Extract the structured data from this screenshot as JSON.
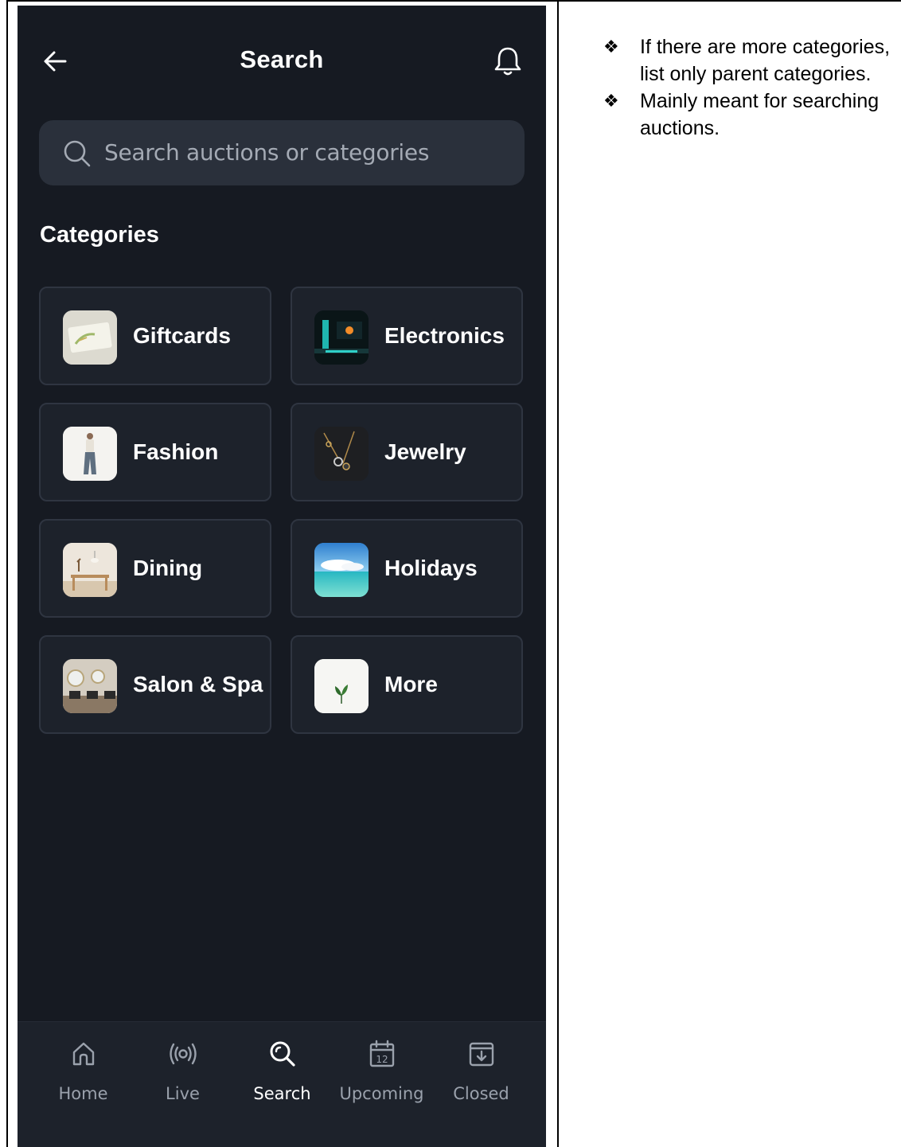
{
  "header": {
    "title": "Search",
    "back_icon": "arrow-left-icon",
    "bell_icon": "bell-icon"
  },
  "search": {
    "placeholder": "Search auctions or categories",
    "icon": "search-icon"
  },
  "categories_title": "Categories",
  "categories": [
    {
      "label": "Giftcards",
      "image": "giftcard-image"
    },
    {
      "label": "Electronics",
      "image": "electronics-image"
    },
    {
      "label": "Fashion",
      "image": "fashion-image"
    },
    {
      "label": "Jewelry",
      "image": "jewelry-image"
    },
    {
      "label": "Dining",
      "image": "dining-image"
    },
    {
      "label": "Holidays",
      "image": "holidays-image"
    },
    {
      "label": "Salon & Spa",
      "image": "salon-image"
    },
    {
      "label": "More",
      "image": "leaf-image"
    }
  ],
  "nav": [
    {
      "label": "Home",
      "icon": "home-icon",
      "active": false
    },
    {
      "label": "Live",
      "icon": "live-broadcast-icon",
      "active": false
    },
    {
      "label": "Search",
      "icon": "search-icon",
      "active": true
    },
    {
      "label": "Upcoming",
      "icon": "calendar-icon",
      "calendar_day": "12",
      "active": false
    },
    {
      "label": "Closed",
      "icon": "archive-icon",
      "active": false
    }
  ],
  "notes": [
    "If there are more categories, list only parent categories.",
    "Mainly meant for searching auctions."
  ],
  "colors": {
    "background": "#161a22",
    "card": "#1d222b",
    "search_box": "#2a303b",
    "muted_text": "#9aa1ac"
  }
}
